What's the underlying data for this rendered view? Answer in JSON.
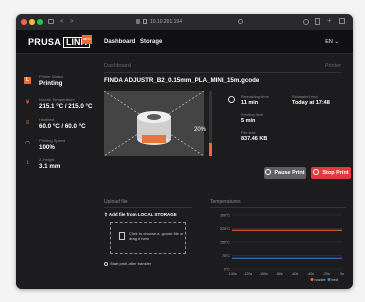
{
  "browser": {
    "address": "10.10.201.194",
    "icons": [
      "sidebar-icon",
      "back-icon",
      "forward-icon",
      "shield-icon",
      "reload-icon",
      "download-icon",
      "share-icon",
      "new-tab-icon",
      "tabs-icon"
    ],
    "back_glyph": "<",
    "forward_glyph": ">"
  },
  "nav": {
    "logo_left": "PRUSA",
    "logo_right": "LINK",
    "logo_badge": "BETA",
    "items": [
      "Dashboard",
      "Storage"
    ],
    "language": "EN ⌄"
  },
  "sidebar": [
    {
      "icon": "printer-icon",
      "label": "Printer Status",
      "value": "Printing"
    },
    {
      "icon": "nozzle-icon",
      "label": "Nozzle Temperature",
      "value": "215.1 °C / 215.0 °C"
    },
    {
      "icon": "heatbed-icon",
      "label": "Heatbed",
      "value": "60.0 °C / 60.0 °C"
    },
    {
      "icon": "speed-icon",
      "label": "Printing Speed",
      "value": "100%"
    },
    {
      "icon": "z-height-icon",
      "label": "Z-Height",
      "value": "3.1 mm"
    }
  ],
  "main": {
    "breadcrumb": "Dashboard",
    "printer_label": "Printer",
    "filename": "FINDA ADJUSTR_B2_0.15mm_PLA_MINI_15m.gcode",
    "progress_percent": 20,
    "progress_text": "20%",
    "info": {
      "remaining_label": "Remaining time",
      "remaining_value": "11 min",
      "estimated_label": "Estimated end",
      "estimated_value": "Today at 17:48",
      "printing_label": "Printing time",
      "printing_value": "5 min",
      "filesize_label": "File size",
      "filesize_value": "837.46 KB"
    },
    "pause_label": "Pause Print",
    "stop_label": "Stop Print",
    "colors": {
      "accent": "#fa6831",
      "stop": "#e6373f",
      "pause": "#6a6a6c",
      "nozzle_line": "#fa6831",
      "bed_line": "#3f7ee0"
    }
  },
  "upload": {
    "title": "Upload file",
    "add_link": "Add file from LOCAL STORAGE",
    "drop_text": "Click to choose a .gcode file or drag it here",
    "start_after": "Start print after transfer"
  },
  "temps": {
    "title": "Temperatures",
    "chart_data": {
      "type": "line",
      "title": "Temperatures",
      "x": [
        -140,
        -120,
        -100,
        -80,
        -60,
        -40,
        -20,
        0
      ],
      "x_tick_labels": [
        "-140s",
        "-120s",
        "-100s",
        "-80s",
        "-60s",
        "-40s",
        "-20s",
        "0s"
      ],
      "ylim": [
        0,
        300
      ],
      "y_ticks": [
        0,
        75,
        150,
        225,
        300
      ],
      "y_tick_labels": [
        "0°C",
        "75°C",
        "150°C",
        "225°C",
        "300°C"
      ],
      "series": [
        {
          "name": "nozzle",
          "color": "#fa6831",
          "values": [
            215,
            215,
            215,
            215,
            215,
            215,
            215,
            215
          ]
        },
        {
          "name": "bed",
          "color": "#3f7ee0",
          "values": [
            60,
            60,
            60,
            60,
            60,
            60,
            60,
            60
          ]
        }
      ],
      "grid": true,
      "legend": "bottom-right"
    }
  }
}
